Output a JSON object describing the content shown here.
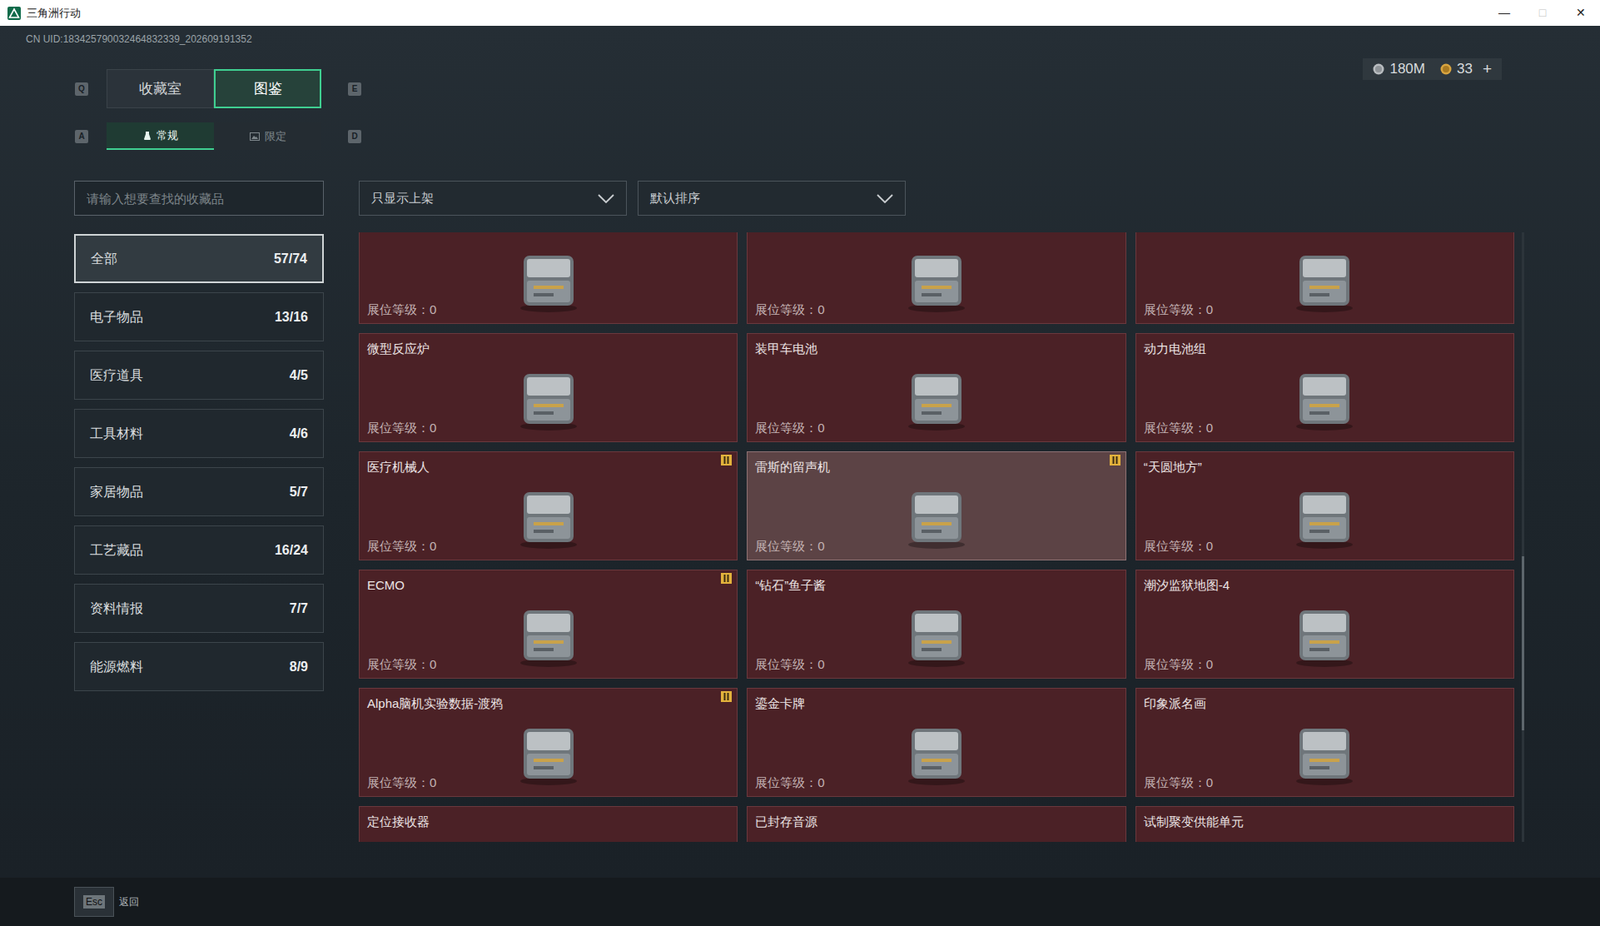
{
  "window": {
    "title": "三角洲行动",
    "controls": [
      {
        "glyph": "—",
        "disabled": false
      },
      {
        "glyph": "□",
        "disabled": true
      },
      {
        "glyph": "✕",
        "disabled": false
      }
    ]
  },
  "uid": "CN UID:183425790032464832339_202609191352",
  "currencies": [
    {
      "amount": "180M"
    },
    {
      "amount": "33",
      "action": "+"
    }
  ],
  "tabs": {
    "prev_key": "Q",
    "next_key": "E",
    "items": [
      {
        "label": "收藏室",
        "selected": false
      },
      {
        "label": "图鉴",
        "selected": true
      }
    ]
  },
  "subtabs": {
    "prev_key": "A",
    "next_key": "D",
    "items": [
      {
        "label": "常规",
        "selected": true
      },
      {
        "label": "限定",
        "selected": false
      }
    ]
  },
  "search": {
    "placeholder": "请输入想要查找的收藏品"
  },
  "filters": [
    {
      "value": "只显示上架"
    },
    {
      "value": "默认排序"
    }
  ],
  "categories": [
    {
      "label": "全部",
      "count": "57/74",
      "selected": true
    },
    {
      "label": "电子物品",
      "count": "13/16",
      "selected": false
    },
    {
      "label": "医疗道具",
      "count": "4/5",
      "selected": false
    },
    {
      "label": "工具材料",
      "count": "4/6",
      "selected": false
    },
    {
      "label": "家居物品",
      "count": "5/7",
      "selected": false
    },
    {
      "label": "工艺藏品",
      "count": "16/24",
      "selected": false
    },
    {
      "label": "资料情报",
      "count": "7/7",
      "selected": false
    },
    {
      "label": "能源燃料",
      "count": "8/9",
      "selected": false
    }
  ],
  "items": [
    {
      "level_text": "展位等级：0",
      "selected": false,
      "alert": false
    },
    {
      "level_text": "展位等级：0",
      "selected": false,
      "alert": false
    },
    {
      "level_text": "展位等级：0",
      "selected": false,
      "alert": false
    },
    {
      "name": "微型反应炉",
      "level_text": "展位等级：0",
      "selected": false,
      "alert": false
    },
    {
      "name": "装甲车电池",
      "level_text": "展位等级：0",
      "selected": false,
      "alert": false
    },
    {
      "name": "动力电池组",
      "level_text": "展位等级：0",
      "selected": false,
      "alert": false
    },
    {
      "name": "医疗机械人",
      "level_text": "展位等级：0",
      "selected": false,
      "alert": true
    },
    {
      "name": "雷斯的留声机",
      "level_text": "展位等级：0",
      "selected": true,
      "alert": true
    },
    {
      "name": "“天圆地方”",
      "level_text": "展位等级：0",
      "selected": false,
      "alert": false
    },
    {
      "name": "ECMO",
      "level_text": "展位等级：0",
      "selected": false,
      "alert": true
    },
    {
      "name": "“钻石”鱼子酱",
      "level_text": "展位等级：0",
      "selected": false,
      "alert": false
    },
    {
      "name": "潮汐监狱地图-4",
      "level_text": "展位等级：0",
      "selected": false,
      "alert": false
    },
    {
      "name": "Alpha脑机实验数据-渡鸦",
      "level_text": "展位等级：0",
      "selected": false,
      "alert": true
    },
    {
      "name": "鎏金卡牌",
      "level_text": "展位等级：0",
      "selected": false,
      "alert": false
    },
    {
      "name": "印象派名画",
      "level_text": "展位等级：0",
      "selected": false,
      "alert": false
    },
    {
      "name": "定位接收器",
      "selected": false,
      "alert": false
    },
    {
      "name": "已封存音源",
      "selected": false,
      "alert": false
    },
    {
      "name": "试制聚变供能单元",
      "selected": false,
      "alert": false
    }
  ],
  "footer": {
    "key": "Esc",
    "label": "返回"
  }
}
